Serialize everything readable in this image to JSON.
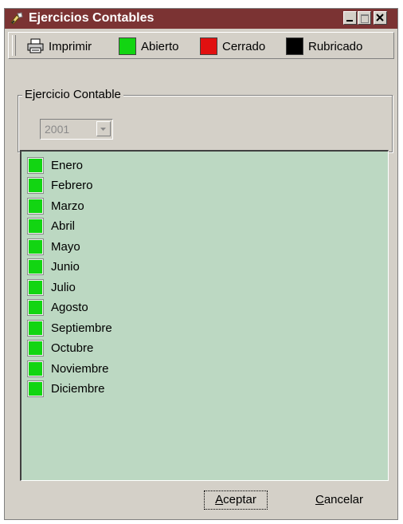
{
  "window": {
    "title": "Ejercicios Contables"
  },
  "toolbar": {
    "print_label": "Imprimir",
    "legend": [
      {
        "label": "Abierto",
        "color": "#12d512"
      },
      {
        "label": "Cerrado",
        "color": "#e11010"
      },
      {
        "label": "Rubricado",
        "color": "#000000"
      }
    ]
  },
  "group": {
    "label": "Ejercicio Contable"
  },
  "combo": {
    "value": "2001"
  },
  "months": [
    "Enero",
    "Febrero",
    "Marzo",
    "Abril",
    "Mayo",
    "Junio",
    "Julio",
    "Agosto",
    "Septiembre",
    "Octubre",
    "Noviembre",
    "Diciembre"
  ],
  "buttons": {
    "accept_mnemonic": "A",
    "accept_rest": "ceptar",
    "cancel_mnemonic": "C",
    "cancel_rest": "ancelar"
  },
  "colors": {
    "titlebar": "#7b3333",
    "list_bg": "#bcd8c2",
    "open": "#12d512"
  }
}
